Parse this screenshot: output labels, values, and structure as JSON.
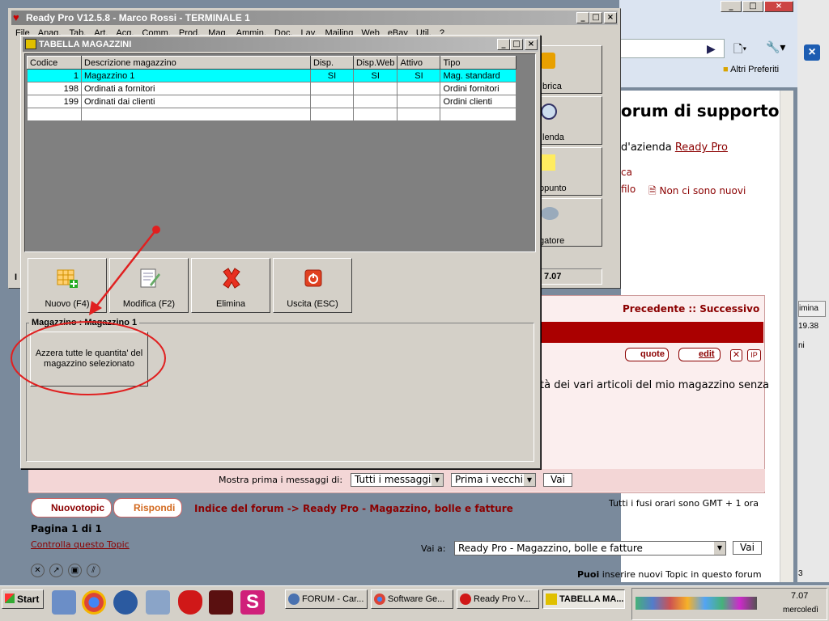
{
  "browser": {
    "bookmark": "Altri Preferiti",
    "forum_title": "orum di supporto",
    "forum_subtitle": "d'azienda",
    "forum_link": "Ready Pro",
    "frag_ca": "ca",
    "frag_filo": "filo",
    "non_nuovi": "Non ci sono nuovi",
    "nav_links": "Precedente :: Successivo",
    "quote_btn": "quote",
    "edit_btn": "edit",
    "post_text": "tà dei vari articoli del mio magazzino senza",
    "mostra_label": "Mostra prima i messaggi di:",
    "mostra_select": "Tutti i messaggi",
    "ordine_select": "Prima i vecchi",
    "vai_label": "Vai",
    "nuovo_topic": "Nuovotopic",
    "rispondi": "Rispondi",
    "breadcrumb": "Indice del forum -> Ready Pro - Magazzino, bolle e fatture",
    "timezone": "Tutti i fusi orari sono GMT + 1 ora",
    "pagina": "Pagina 1 di 1",
    "controlla": "Controlla questo Topic",
    "vai_a_label": "Vai a:",
    "vai_a_select": "Ready Pro - Magazzino, bolle e fatture",
    "puoi_text_bold": "Puoi",
    "puoi_text": "inserire nuovi Topic in questo forum",
    "side_time": "19.38",
    "side_elimina": "imina",
    "side_ni": "ni",
    "side_num": "3"
  },
  "readypro": {
    "title": "Ready Pro V12.5.8 - Marco Rossi - TERMINALE 1",
    "menu": [
      "File",
      "Anag.",
      "Tab.",
      "Art.",
      "Acq.",
      "Comm.",
      "Prod.",
      "Mag.",
      "Ammin.",
      "Doc.",
      "Lav.",
      "Mailing",
      "Web",
      "eBay",
      "Util.",
      "?"
    ],
    "side_buttons": [
      "brica",
      "lenda",
      "ppunto",
      "gatore"
    ],
    "status_time": "7.07",
    "status_left": "I"
  },
  "tabella": {
    "title": "TABELLA MAGAZZINI",
    "columns": [
      "Codice",
      "Descrizione magazzino",
      "Disp.",
      "Disp.Web",
      "Attivo",
      "Tipo"
    ],
    "rows": [
      {
        "codice": "1",
        "descrizione": "Magazzino 1",
        "disp": "SI",
        "dispweb": "SI",
        "attivo": "SI",
        "tipo": "Mag. standard"
      },
      {
        "codice": "198",
        "descrizione": "Ordinati a fornitori",
        "disp": "",
        "dispweb": "",
        "attivo": "",
        "tipo": "Ordini fornitori"
      },
      {
        "codice": "199",
        "descrizione": "Ordinati dai clienti",
        "disp": "",
        "dispweb": "",
        "attivo": "",
        "tipo": "Ordini clienti"
      }
    ],
    "buttons": {
      "nuovo": "Nuovo (F4)",
      "modifica": "Modifica (F2)",
      "elimina": "Elimina",
      "uscita": "Uscita (ESC)"
    },
    "group_title": "Magazzino : Magazzino 1",
    "azzera": "Azzera tutte le quantita' del magazzino selezionato"
  },
  "taskbar": {
    "start": "Start",
    "tasks": [
      "FORUM - Car...",
      "Software Ge...",
      "Ready Pro V...",
      "TABELLA MA..."
    ],
    "time": "7.07",
    "day": "mercoledì"
  },
  "colors": {
    "selection": "#00ffff",
    "forum_red": "#8b0000",
    "annotation": "#e02020"
  }
}
